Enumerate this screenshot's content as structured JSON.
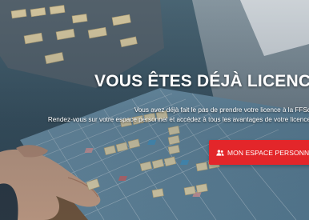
{
  "hero": {
    "headline": "VOUS ÊTES DÉJÀ LICENCIÉ(E)",
    "line1": "Vous avez déjà fait le pas de prendre votre licence à la FFSc",
    "line2": "Rendez-vous sur votre espace personnel et accédez à tous les avantages de votre licence",
    "cta_label": "MON ESPACE PERSONNEL",
    "cta_icon": "users-icon",
    "background": "photo-hand-placing-scrabble-tile-on-board"
  },
  "colors": {
    "cta": "#e3262a",
    "text": "#ffffff"
  }
}
